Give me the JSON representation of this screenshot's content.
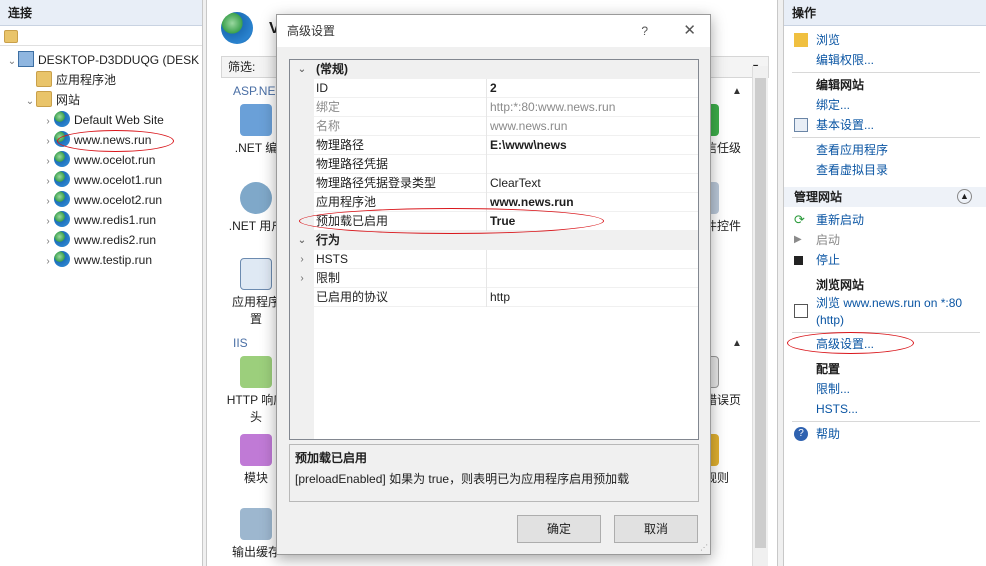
{
  "connections": {
    "title": "连接",
    "tree": [
      {
        "label": "DESKTOP-D3DDUQG (DESK",
        "level": 0,
        "icon": "computer-icon",
        "expanded": true
      },
      {
        "label": "应用程序池",
        "level": 1,
        "icon": "app-pool-icon"
      },
      {
        "label": "网站",
        "level": 1,
        "icon": "folder-icon",
        "expanded": true
      },
      {
        "label": "Default Web Site",
        "level": 2,
        "icon": "globe-icon"
      },
      {
        "label": "www.news.run",
        "level": 2,
        "icon": "globe-icon",
        "selected": true
      },
      {
        "label": "www.ocelot.run",
        "level": 2,
        "icon": "globe-icon"
      },
      {
        "label": "www.ocelot1.run",
        "level": 2,
        "icon": "globe-icon"
      },
      {
        "label": "www.ocelot2.run",
        "level": 2,
        "icon": "globe-icon"
      },
      {
        "label": "www.redis1.run",
        "level": 2,
        "icon": "globe-icon"
      },
      {
        "label": "www.redis2.run",
        "level": 2,
        "icon": "globe-icon"
      },
      {
        "label": "www.testip.run",
        "level": 2,
        "icon": "globe-icon"
      }
    ]
  },
  "main": {
    "title_partial": "V",
    "filter_label": "筛选:",
    "groups": {
      "aspnet": "ASP.NE",
      "iis": "IIS"
    },
    "features": [
      {
        "label": ".NET 编",
        "icon": "dotnet-compile-icon"
      },
      {
        "label": ".NET 用户",
        "icon": "dotnet-users-icon"
      },
      {
        "label": "应用程序\n置",
        "icon": "app-settings-icon"
      },
      {
        "label": "HTTP 响应\n头",
        "icon": "http-headers-icon"
      },
      {
        "label": "模块",
        "icon": "modules-icon"
      },
      {
        "label": "输出缓存",
        "icon": "output-cache-icon"
      },
      {
        "label": "信任级",
        "icon": "trust-level-icon"
      },
      {
        "label": "件控件",
        "icon": "controls-icon"
      },
      {
        "label": "错误页",
        "icon": "error-pages-icon"
      },
      {
        "label": "规则",
        "icon": "rules-icon"
      }
    ]
  },
  "dialog": {
    "title": "高级设置",
    "help": "?",
    "close": "✕",
    "categories": {
      "general": "(常规)",
      "behavior": "行为"
    },
    "properties": [
      {
        "name": "ID",
        "value": "2",
        "bold": true
      },
      {
        "name": "绑定",
        "value": "http:*:80:www.news.run",
        "readonly": true
      },
      {
        "name": "名称",
        "value": "www.news.run",
        "readonly": true
      },
      {
        "name": "物理路径",
        "value": "E:\\www\\news",
        "bold": true
      },
      {
        "name": "物理路径凭据",
        "value": ""
      },
      {
        "name": "物理路径凭据登录类型",
        "value": "ClearText"
      },
      {
        "name": "应用程序池",
        "value": "www.news.run",
        "bold": true
      },
      {
        "name": "预加载已启用",
        "value": "True",
        "bold": true
      }
    ],
    "behavior_properties": [
      {
        "name": "HSTS",
        "value": "",
        "expandable": true
      },
      {
        "name": "限制",
        "value": "",
        "expandable": true
      },
      {
        "name": "已启用的协议",
        "value": "http"
      }
    ],
    "description": {
      "title": "预加载已启用",
      "text": "[preloadEnabled] 如果为 true，则表明已为应用程序启用预加载"
    },
    "ok": "确定",
    "cancel": "取消"
  },
  "actions": {
    "title": "操作",
    "browse": "浏览",
    "edit_perms": "编辑权限...",
    "edit_site_hdr": "编辑网站",
    "bindings": "绑定...",
    "basic_settings": "基本设置...",
    "view_apps": "查看应用程序",
    "view_vdirs": "查看虚拟目录",
    "manage_hdr": "管理网站",
    "restart": "重新启动",
    "start": "启动",
    "stop": "停止",
    "browse_site_hdr": "浏览网站",
    "browse_site_line1": "浏览 www.news.run on *:80",
    "browse_site_line2": "(http)",
    "advanced_settings": "高级设置...",
    "config_hdr": "配置",
    "limits": "限制...",
    "hsts": "HSTS...",
    "help": "帮助"
  },
  "colors": {
    "link": "#0a55a3",
    "annotation": "#d9161b"
  }
}
